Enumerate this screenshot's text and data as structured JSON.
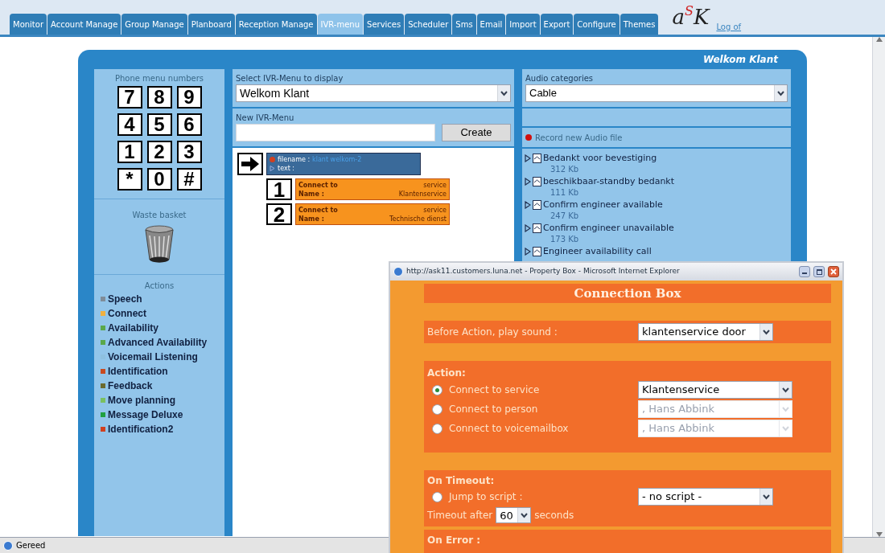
{
  "tabs": [
    {
      "label": "Monitor",
      "selected": false
    },
    {
      "label": "Account Manage",
      "selected": false
    },
    {
      "label": "Group Manage",
      "selected": false
    },
    {
      "label": "Planboard",
      "selected": false
    },
    {
      "label": "Reception Manage",
      "selected": false
    },
    {
      "label": "IVR-menu",
      "selected": true
    },
    {
      "label": "Services",
      "selected": false
    },
    {
      "label": "Scheduler",
      "selected": false
    },
    {
      "label": "Sms",
      "selected": false
    },
    {
      "label": "Email",
      "selected": false
    },
    {
      "label": "Import",
      "selected": false
    },
    {
      "label": "Export",
      "selected": false
    },
    {
      "label": "Configure",
      "selected": false
    },
    {
      "label": "Themes",
      "selected": false
    }
  ],
  "logo": "aSK",
  "logout_link": "Log of",
  "panel_title": "Welkom Klant",
  "keypad": {
    "title": "Phone menu numbers",
    "keys": [
      "7",
      "8",
      "9",
      "4",
      "5",
      "6",
      "1",
      "2",
      "3",
      "*",
      "0",
      "#"
    ]
  },
  "waste_basket": {
    "title": "Waste basket"
  },
  "actions": {
    "title": "Actions",
    "items": [
      {
        "label": "Speech",
        "color": "#7f8c99"
      },
      {
        "label": "Connect",
        "color": "#f0b040"
      },
      {
        "label": "Availability",
        "color": "#5aa84a"
      },
      {
        "label": "Advanced Availability",
        "color": "#5aa84a"
      },
      {
        "label": "Voicemail Listening",
        "color": "#8ec0e0"
      },
      {
        "label": "Identification",
        "color": "#c84a20"
      },
      {
        "label": "Feedback",
        "color": "#6a6a30"
      },
      {
        "label": "Move planning",
        "color": "#7ac060"
      },
      {
        "label": "Message Deluxe",
        "color": "#20a040"
      },
      {
        "label": "Identification2",
        "color": "#d04020"
      }
    ]
  },
  "ivr_select": {
    "label": "Select IVR-Menu to display",
    "value": "Welkom Klant"
  },
  "new_ivr": {
    "label": "New IVR-Menu",
    "button": "Create"
  },
  "start_node": {
    "filename_label": "filename :",
    "filename_value": "klant welkom-2",
    "text_label": "text :"
  },
  "menu_nodes": [
    {
      "key": "1",
      "connect_label": "Connect to",
      "connect_value": "service",
      "name_label": "Name :",
      "name_value": "Klantenservice"
    },
    {
      "key": "2",
      "connect_label": "Connect to",
      "connect_value": "service",
      "name_label": "Name :",
      "name_value": "Technische dienst"
    }
  ],
  "audio": {
    "label": "Audio categories",
    "value": "Cable",
    "record": "Record new Audio file",
    "files": [
      {
        "name": "Bedankt voor bevestiging",
        "size": "312 Kb"
      },
      {
        "name": "beschikbaar-standby bedankt",
        "size": "111 Kb"
      },
      {
        "name": "Confirm engineer available",
        "size": "247 Kb"
      },
      {
        "name": "Confirm engineer unavailable",
        "size": "173 Kb"
      },
      {
        "name": "Engineer availability call"
      }
    ]
  },
  "status_bar": {
    "text": "Gereed"
  },
  "popup": {
    "title": "http://ask11.customers.luna.net - Property Box - Microsoft Internet Explorer",
    "heading": "Connection Box",
    "before_action": {
      "label": "Before Action, play sound :",
      "value": "klantenservice door"
    },
    "action": {
      "title": "Action:",
      "options": [
        {
          "label": "Connect to service",
          "selected": true,
          "value": "Klantenservice",
          "disabled": false
        },
        {
          "label": "Connect to person",
          "selected": false,
          "value": ", Hans Abbink",
          "disabled": true
        },
        {
          "label": "Connect to voicemailbox",
          "selected": false,
          "value": ", Hans Abbink",
          "disabled": true
        }
      ]
    },
    "timeout": {
      "title": "On Timeout:",
      "jump_label": "Jump to script :",
      "jump_selected": false,
      "script": "- no script -",
      "after_label": "Timeout after",
      "seconds_value": "60",
      "seconds_label": "seconds"
    },
    "error": {
      "title": "On Error :"
    }
  }
}
